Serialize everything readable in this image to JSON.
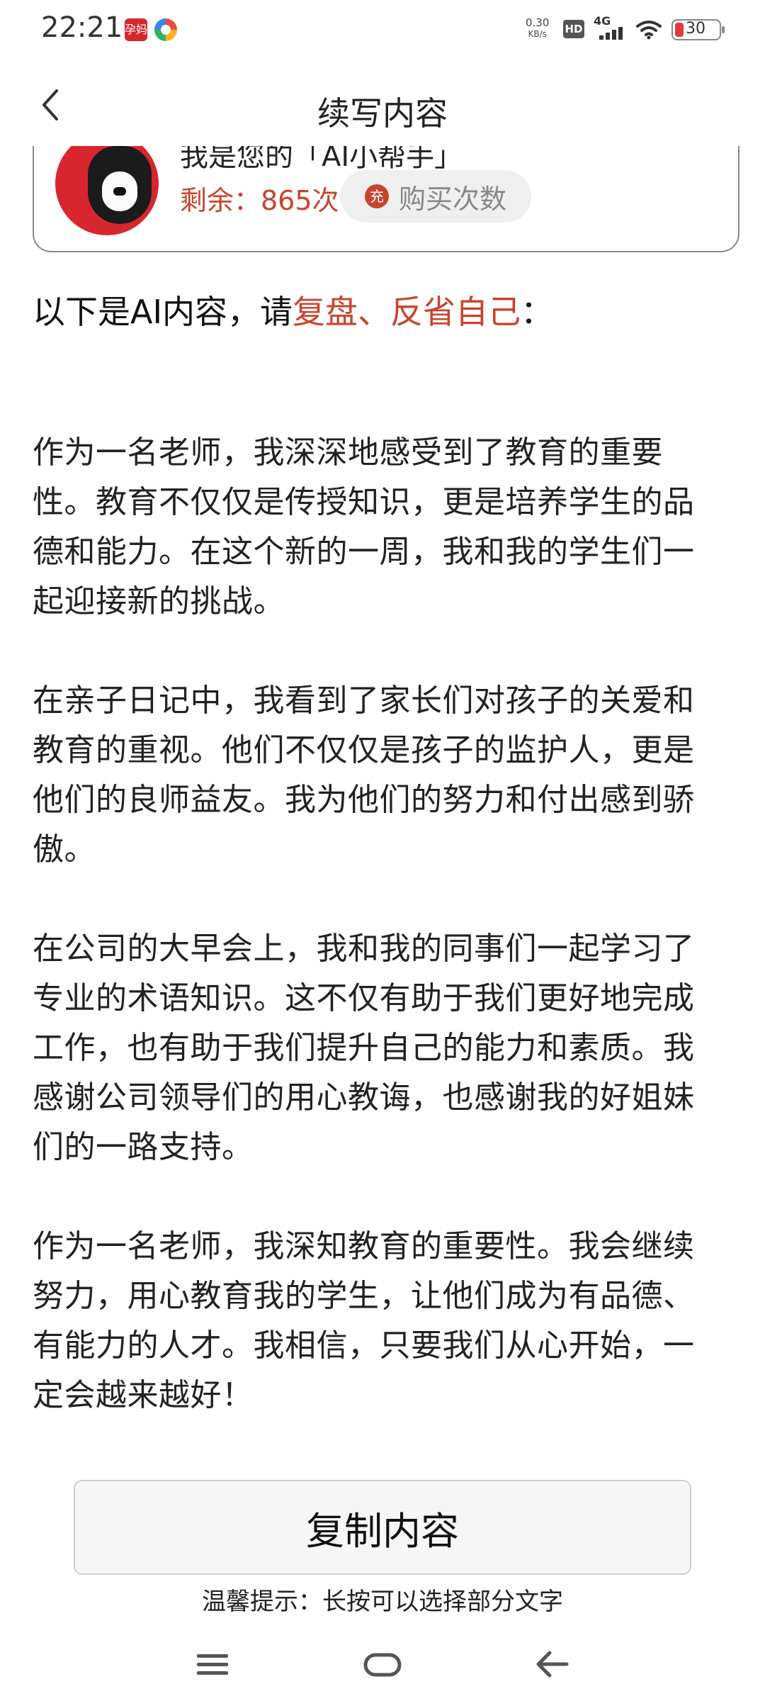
{
  "status_bar": {
    "time": "22:21",
    "app_badge_text": "孕妈",
    "net_speed_value": "0.30",
    "net_speed_unit": "KB/s",
    "hd_label": "HD",
    "network_type": "4G",
    "battery_level": "30"
  },
  "header": {
    "title": "续写内容"
  },
  "card": {
    "subtitle": "我是您的「AI小帮手」",
    "remaining": "剩余：865次",
    "buy_icon": "充",
    "buy_label": "购买次数"
  },
  "intro": {
    "prefix": "以下是AI内容，请",
    "accent": "复盘、反省自己",
    "suffix": "："
  },
  "content": {
    "paragraphs": [
      "作为一名老师，我深深地感受到了教育的重要性。教育不仅仅是传授知识，更是培养学生的品德和能力。在这个新的一周，我和我的学生们一起迎接新的挑战。",
      "在亲子日记中，我看到了家长们对孩子的关爱和教育的重视。他们不仅仅是孩子的监护人，更是他们的良师益友。我为他们的努力和付出感到骄傲。",
      "在公司的大早会上，我和我的同事们一起学习了专业的术语知识。这不仅有助于我们更好地完成工作，也有助于我们提升自己的能力和素质。我感谢公司领导们的用心教诲，也感谢我的好姐妹们的一路支持。",
      "作为一名老师，我深知教育的重要性。我会继续努力，用心教育我的学生，让他们成为有品德、有能力的人才。我相信，只要我们从心开始，一定会越来越好！"
    ]
  },
  "actions": {
    "copy_label": "复制内容",
    "tip": "温馨提示：长按可以选择部分文字"
  },
  "colors": {
    "accent": "#c8442e",
    "avatar_bg": "#d8262e"
  },
  "icons": {
    "back": "chevron-left-icon",
    "menu": "menu-icon",
    "home": "home-icon",
    "nav_back": "arrow-left-icon"
  }
}
